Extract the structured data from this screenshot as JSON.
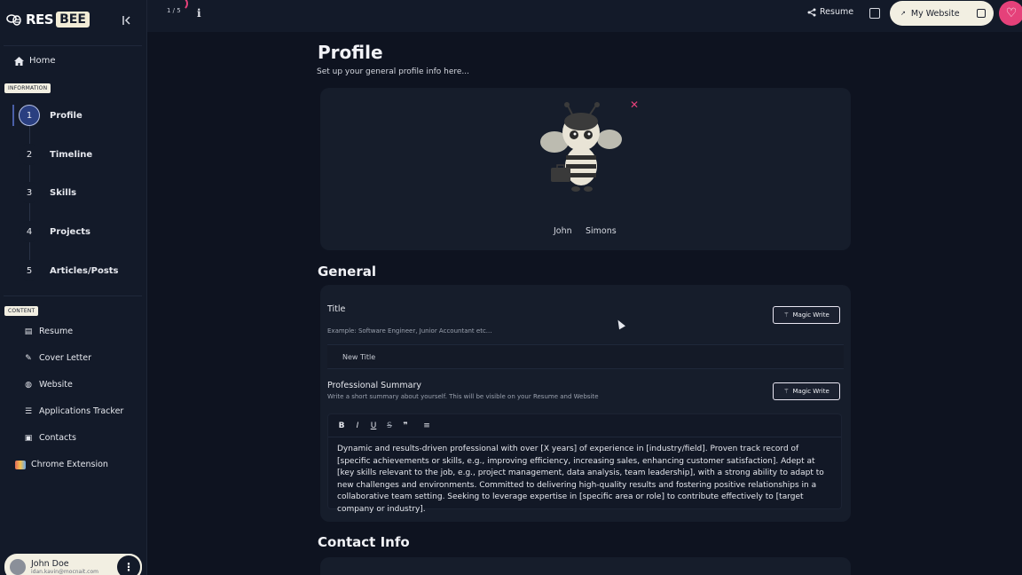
{
  "sidebar": {
    "logo": {
      "res": "RES",
      "bee": "BEE"
    },
    "home": "Home",
    "information_tag": "INFORMATION",
    "steps": [
      {
        "num": "1",
        "label": "Profile",
        "active": true
      },
      {
        "num": "2",
        "label": "Timeline"
      },
      {
        "num": "3",
        "label": "Skills"
      },
      {
        "num": "4",
        "label": "Projects"
      },
      {
        "num": "5",
        "label": "Articles/Posts"
      }
    ],
    "content_tag": "CONTENT",
    "content_items": [
      {
        "label": "Resume",
        "icon": "resume-icon"
      },
      {
        "label": "Cover Letter",
        "icon": "pen-icon"
      },
      {
        "label": "Website",
        "icon": "globe-icon"
      },
      {
        "label": "Applications Tracker",
        "icon": "list-icon"
      },
      {
        "label": "Contacts",
        "icon": "contacts-icon"
      }
    ],
    "chrome_extension": "Chrome Extension",
    "user": {
      "name": "John Doe",
      "email": "idan.kavin@mocnait.com"
    }
  },
  "topbar": {
    "progress": "1 / 5",
    "resume": "Resume",
    "website": "My Website",
    "accent": "#e5417a"
  },
  "main": {
    "title": "Profile",
    "subtitle": "Set up your general profile info here...",
    "first_name": "John",
    "last_name": "Simons",
    "general": {
      "heading": "General",
      "title_label": "Title",
      "title_hint": "Example: Software Engineer, Junior Accountant etc...",
      "title_value": "New Title",
      "magic_write": "Magic Write",
      "summary_label": "Professional Summary",
      "summary_hint": "Write a short summary about yourself. This will be visible on your Resume and Website",
      "summary_text": "Dynamic and results-driven professional with over [X years] of experience in [industry/field]. Proven track record of [specific achievements or skills, e.g., improving efficiency, increasing sales, enhancing customer satisfaction]. Adept at [key skills relevant to the job, e.g., project management, data analysis, team leadership], with a strong ability to adapt to new challenges and environments. Committed to delivering high-quality results and fostering positive relationships in a collaborative team setting. Seeking to leverage expertise in [specific area or role] to contribute effectively to [target company or industry]."
    },
    "contact_heading": "Contact Info"
  }
}
